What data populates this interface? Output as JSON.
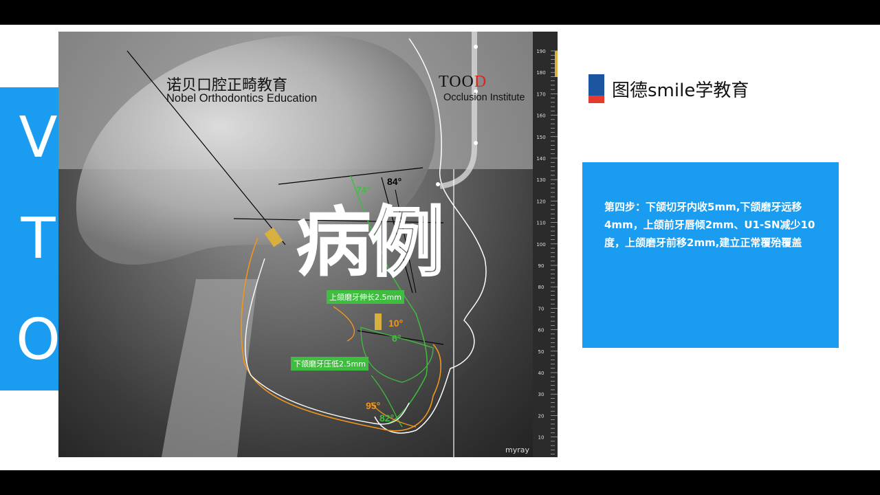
{
  "vto": [
    "V",
    "T",
    "O"
  ],
  "logos": {
    "nobel_cn": "诺贝口腔正畸教育",
    "nobel_en": "Nobel Orthodontics Education",
    "tood_prefix": "TOO",
    "tood_suffix": "D",
    "tood_sub": "Occlusion Institute"
  },
  "xray": {
    "watermark_fill": "病",
    "watermark_outline": "例",
    "label_upper": "上颌磨牙伸长2.5mm",
    "label_lower": "下颌磨牙压低2.5mm",
    "angles": [
      "74°",
      "84°",
      "10°",
      "6°",
      "95°",
      "82°"
    ],
    "ruler_ticks": [
      "190",
      "180",
      "170",
      "160",
      "150",
      "140",
      "130",
      "120",
      "110",
      "100",
      "90",
      "80",
      "70",
      "60",
      "50",
      "40",
      "30",
      "20",
      "10"
    ],
    "brand_mark": "myray"
  },
  "brand": {
    "name": "图德smile学教育"
  },
  "step": {
    "text": "第四步：下颌切牙内收5mm,下颌磨牙远移4mm，上颌前牙唇倾2mm、U1-SN减少10度，上颌磨牙前移2mm,建立正常覆殆覆盖"
  },
  "colors": {
    "accent_blue": "#1a9cf0",
    "brand_blue": "#1d56a0",
    "brand_red": "#e63a2e",
    "green": "#3ebd3e",
    "orange": "#f0961e"
  }
}
